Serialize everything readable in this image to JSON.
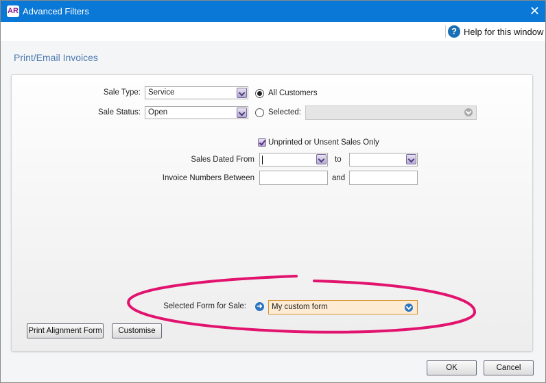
{
  "window": {
    "app_icon_text": "AR",
    "title": "Advanced Filters",
    "close_glyph": "✕"
  },
  "help": {
    "icon": "?",
    "label": "Help for this window"
  },
  "heading": "Print/Email Invoices",
  "filters": {
    "sale_type": {
      "label": "Sale Type:",
      "value": "Service"
    },
    "sale_status": {
      "label": "Sale Status:",
      "value": "Open"
    },
    "customers": {
      "all_label": "All Customers",
      "all_selected": true,
      "selected_label": "Selected:",
      "selected_value": ""
    },
    "unprinted_only": {
      "label": "Unprinted or Unsent Sales Only",
      "checked": true
    },
    "dated_from": {
      "label": "Sales Dated From",
      "from_value": "",
      "to_label": "to",
      "to_value": ""
    },
    "invoice_numbers": {
      "label": "Invoice Numbers Between",
      "from_value": "",
      "and_label": "and",
      "to_value": ""
    }
  },
  "form": {
    "label": "Selected Form for Sale:",
    "value": "My custom form",
    "highlight_color": "#e2136e"
  },
  "buttons": {
    "print_alignment": "Print Alignment Form",
    "customise": "Customise",
    "ok": "OK",
    "cancel": "Cancel"
  }
}
